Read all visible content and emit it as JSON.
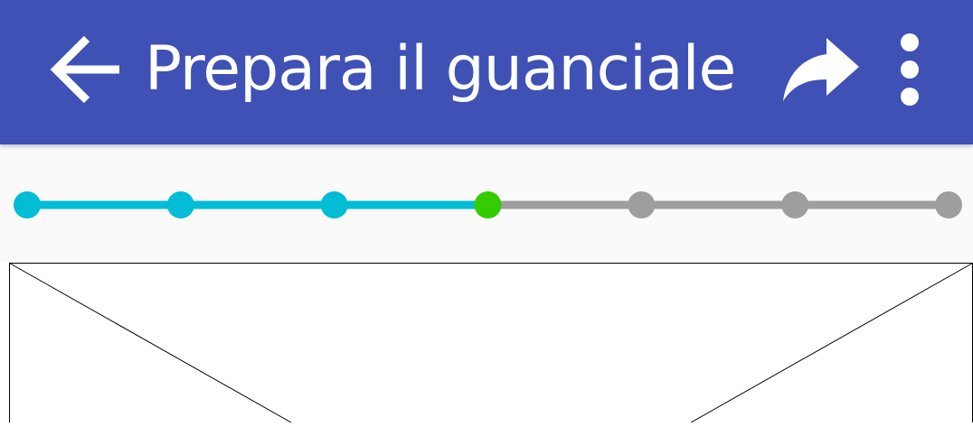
{
  "app_bar": {
    "title": "Prepara il guanciale",
    "background_color": "#3f51b5",
    "back_icon": "arrow-back-icon",
    "share_icon": "share-icon",
    "more_icon": "more-vert-icon"
  },
  "stepper": {
    "total_steps": 7,
    "current_step": 4,
    "completed_color": "#00bcd4",
    "current_color": "#33cc00",
    "pending_color": "#9e9e9e"
  },
  "image_placeholder": {
    "icon": "image-placeholder-icon"
  }
}
